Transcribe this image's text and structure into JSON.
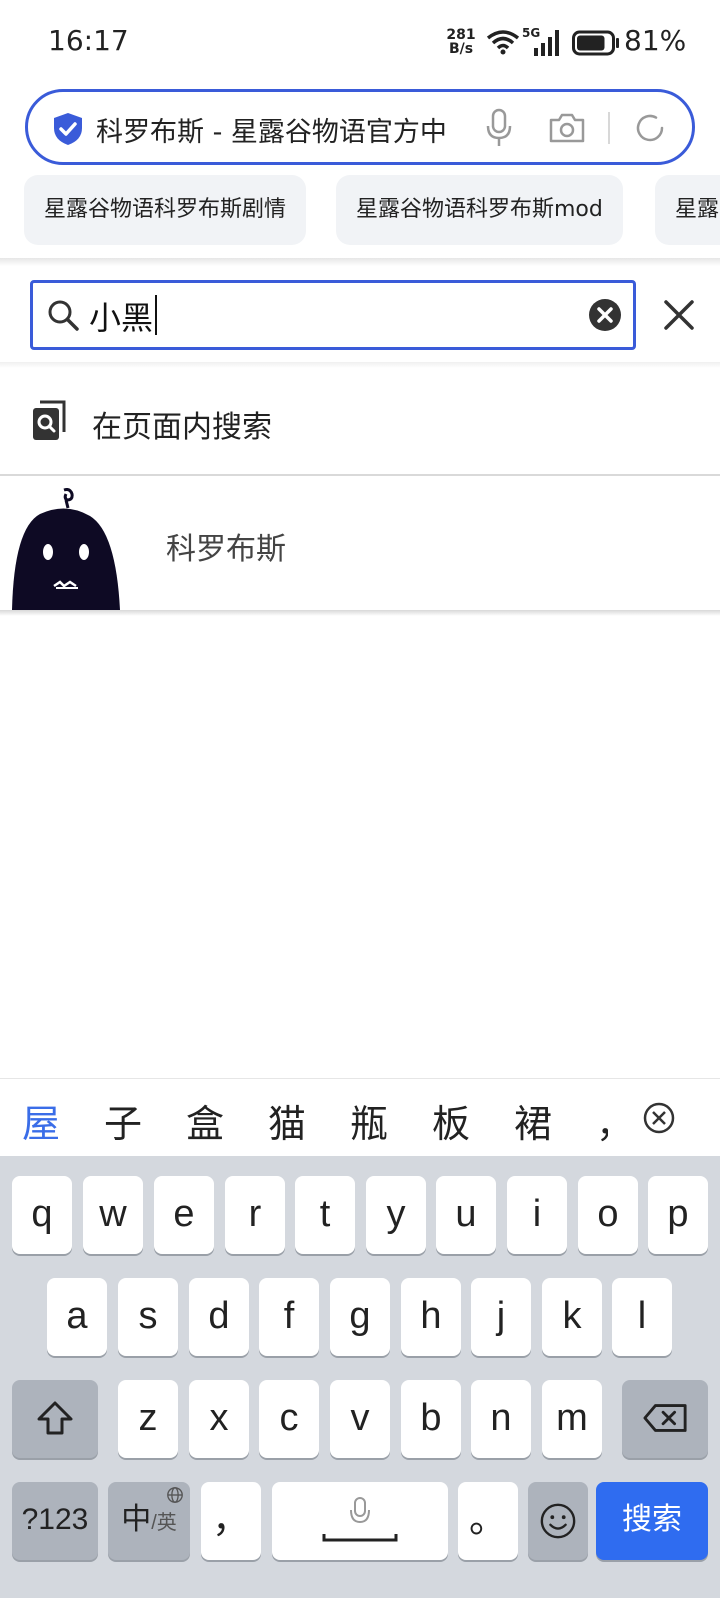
{
  "status_bar": {
    "time": "16:17",
    "net_speed_top": "281",
    "net_speed_bottom": "B/s",
    "network": "5G",
    "battery_pct": "81%",
    "battery_level": 0.81
  },
  "address_bar": {
    "title": "科罗布斯 - 星露谷物语官方中"
  },
  "suggestion_chips": [
    {
      "label": "星露谷物语科罗布斯剧情"
    },
    {
      "label": "星露谷物语科罗布斯mod"
    },
    {
      "label": "星露谷"
    }
  ],
  "find_in_page": {
    "query": "小黑"
  },
  "results": {
    "search_in_page_label": "在页面内搜索",
    "item_label": "科罗布斯"
  },
  "candidates": [
    "屋",
    "子",
    "盒",
    "猫",
    "瓶",
    "板",
    "裙",
    "，"
  ],
  "keyboard": {
    "row1": [
      "q",
      "w",
      "e",
      "r",
      "t",
      "y",
      "u",
      "i",
      "o",
      "p"
    ],
    "row2": [
      "a",
      "s",
      "d",
      "f",
      "g",
      "h",
      "j",
      "k",
      "l"
    ],
    "row3": [
      "z",
      "x",
      "c",
      "v",
      "b",
      "n",
      "m"
    ],
    "sym_key": "?123",
    "lang_key_main": "中",
    "lang_key_sub": "/英",
    "comma_key": "，",
    "period_key": "。",
    "enter_key": "搜索"
  },
  "colors": {
    "accent": "#3a5bd9",
    "enter_key": "#2f6cf0",
    "candidate_highlight": "#3a6de8"
  }
}
